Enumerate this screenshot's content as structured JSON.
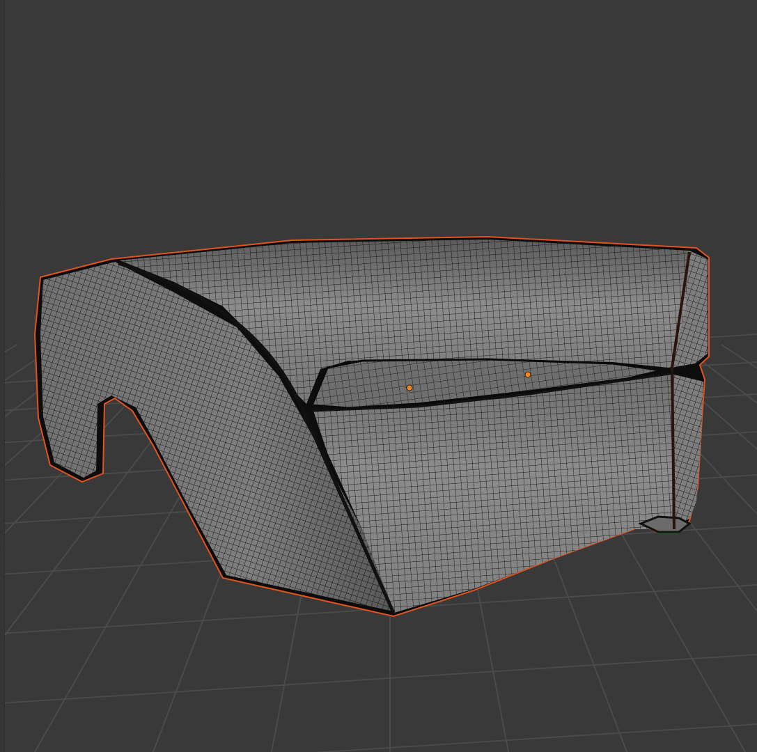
{
  "viewport": {
    "mode": "3d-viewport",
    "shading": "solid-wireframe-overlay",
    "background_color": "#393939",
    "grid_color": "#4a4a4a",
    "mesh_fill_color": "#8e8e8e",
    "mesh_wire_color": "#1c1c1c",
    "selection_outline_color": "#e2541e",
    "selected_vertex_color": "#f08a24"
  },
  "objects": [
    {
      "name_icon": "mesh-object",
      "selected": true
    }
  ]
}
